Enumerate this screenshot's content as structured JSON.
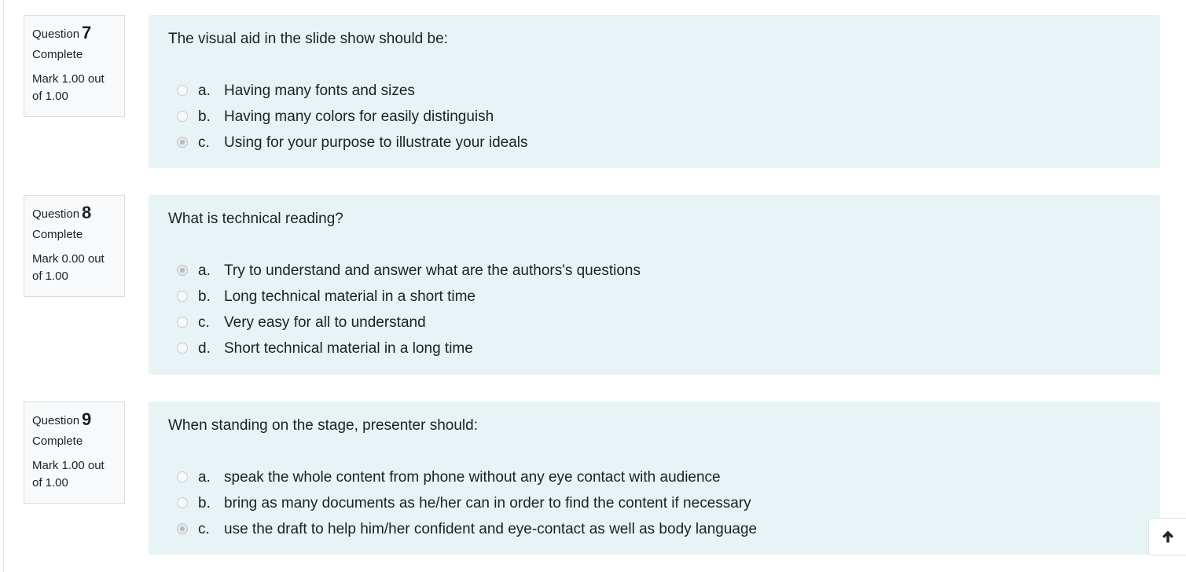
{
  "questions": [
    {
      "label": "Question",
      "number": "7",
      "state": "Complete",
      "grade": "Mark 1.00 out of 1.00",
      "text": "The visual aid in the slide show should be:",
      "answers": [
        {
          "letter": "a.",
          "text": "Having many fonts and sizes",
          "selected": false
        },
        {
          "letter": "b.",
          "text": "Having many colors for easily distinguish",
          "selected": false
        },
        {
          "letter": "c.",
          "text": "Using for your purpose to illustrate your ideals",
          "selected": true
        }
      ]
    },
    {
      "label": "Question",
      "number": "8",
      "state": "Complete",
      "grade": "Mark 0.00 out of 1.00",
      "text": "What is technical reading?",
      "answers": [
        {
          "letter": "a.",
          "text": "Try to understand and answer what are the authors's questions",
          "selected": true
        },
        {
          "letter": "b.",
          "text": "Long technical material in a short time",
          "selected": false
        },
        {
          "letter": "c.",
          "text": "Very easy for all to understand",
          "selected": false
        },
        {
          "letter": "d.",
          "text": "Short technical material in a long time",
          "selected": false
        }
      ]
    },
    {
      "label": "Question",
      "number": "9",
      "state": "Complete",
      "grade": "Mark 1.00 out of 1.00",
      "text": "When standing on the stage, presenter should:",
      "answers": [
        {
          "letter": "a.",
          "text": "speak the whole content from phone without any eye contact with audience",
          "selected": false
        },
        {
          "letter": "b.",
          "text": "bring as many documents as he/her can in order to find the content if necessary",
          "selected": false
        },
        {
          "letter": "c.",
          "text": "use the draft to help him/her confident and eye-contact as well as body language",
          "selected": true
        }
      ]
    }
  ],
  "back_to_top": {
    "icon": "arrow-up-icon"
  },
  "colors": {
    "content_bg": "#e7f3f5",
    "info_bg": "#f8f9fa",
    "text": "#1d2125"
  }
}
